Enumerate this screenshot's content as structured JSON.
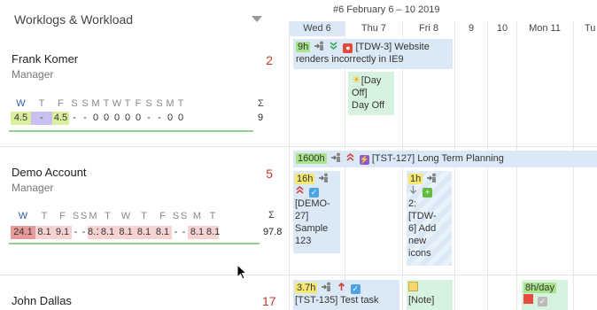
{
  "panel": {
    "title": "Worklogs & Workload"
  },
  "calendar": {
    "week_label": "#6 February 6 – 10 2019",
    "columns": [
      "Wed 6",
      "Thu 7",
      "Fri 8",
      "9",
      "10",
      "Mon 11",
      "Tu"
    ]
  },
  "people": [
    {
      "name": "Frank Komer",
      "role": "Manager",
      "count": "2",
      "days": [
        "W",
        "T",
        "F",
        "S",
        "S",
        "M",
        "T",
        "W",
        "T",
        "F",
        "S",
        "S",
        "M",
        "T"
      ],
      "values": [
        "4.5",
        "-",
        "4.5",
        "-",
        "-",
        "0",
        "0",
        "0",
        "0",
        "0",
        "-",
        "-",
        "0",
        "0"
      ],
      "sigma": "Σ",
      "total": "9"
    },
    {
      "name": "Demo Account",
      "role": "Manager",
      "count": "5",
      "days": [
        "W",
        "T",
        "F",
        "S",
        "S",
        "M",
        "T",
        "W",
        "T",
        "F",
        "S",
        "S",
        "M",
        "T"
      ],
      "values": [
        "24.1",
        "8.1",
        "9.1",
        "-",
        "-",
        "8.1",
        "8.1",
        "8.1",
        "8.1",
        "8.1",
        "-",
        "-",
        "8.1",
        "8.1"
      ],
      "sigma": "Σ",
      "total": "97.8"
    },
    {
      "name": "John Dallas",
      "count": "17"
    }
  ],
  "cards": {
    "c1": {
      "hours": "9h",
      "text1": "[TDW-3] Website",
      "text2": "renders incorrectly in IE9"
    },
    "c2": {
      "text1": "[Day",
      "text2": "Off]",
      "text3": "Day Off"
    },
    "c3": {
      "hours": "1600h",
      "text": "[TST-127] Long Term Planning"
    },
    "c4": {
      "hours": "16h",
      "lines": [
        "[DEMO-",
        "27]",
        "Sample",
        "123"
      ]
    },
    "c5": {
      "hours": "1h",
      "lines": [
        "2:",
        "[TDW-",
        "6] Add",
        "new",
        "icons"
      ]
    },
    "c6": {
      "hours": "3.7h",
      "text": "[TST-135] Test task"
    },
    "c7": {
      "text": "[Note]"
    },
    "c8": {
      "hours": "8h/day"
    }
  }
}
